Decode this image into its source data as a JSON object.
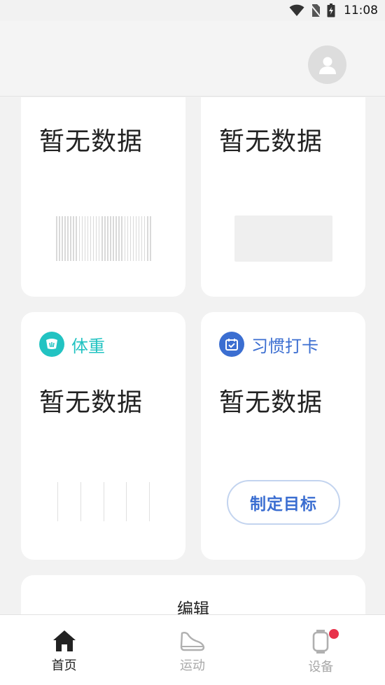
{
  "status_bar": {
    "time": "11:08",
    "icons": [
      "wifi-icon",
      "no-sim-icon",
      "battery-charging-icon"
    ]
  },
  "header": {
    "avatar_icon": "user-avatar-icon"
  },
  "cards": {
    "top_left": {
      "no_data": "暂无数据"
    },
    "top_right": {
      "no_data": "暂无数据"
    },
    "weight": {
      "title": "体重",
      "no_data": "暂无数据",
      "icon": "scale-icon",
      "accent": "#22c3c2"
    },
    "habit": {
      "title": "习惯打卡",
      "no_data": "暂无数据",
      "icon": "calendar-check-icon",
      "accent": "#3b6ed1",
      "goal_button": "制定目标"
    }
  },
  "edit": {
    "label": "编辑"
  },
  "bottom_nav": {
    "items": [
      {
        "label": "首页",
        "icon": "home-icon",
        "active": true
      },
      {
        "label": "运动",
        "icon": "shoe-icon",
        "active": false
      },
      {
        "label": "设备",
        "icon": "watch-icon",
        "active": false,
        "badge": true
      }
    ],
    "badge_color": "#e8314a"
  }
}
